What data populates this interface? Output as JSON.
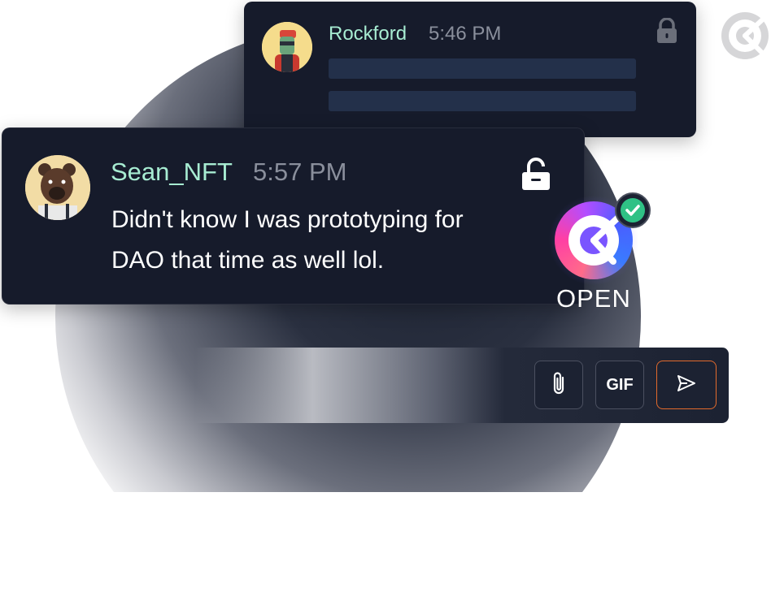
{
  "messages": {
    "rockford": {
      "name": "Rockford",
      "time": "5:46 PM",
      "avatar_icon": "punk-avatar-icon",
      "lock_icon": "lock-closed-icon"
    },
    "sean": {
      "name": "Sean_NFT",
      "time": "5:57 PM",
      "text": "Didn't know I was prototyping for DAO that time as well lol.",
      "avatar_icon": "bear-avatar-icon",
      "lock_icon": "lock-open-icon"
    }
  },
  "status": {
    "label": "OPEN",
    "icon": "check-circle-icon"
  },
  "composer": {
    "attach_icon": "paperclip-icon",
    "gif_label": "GIF",
    "send_icon": "send-icon"
  },
  "colors": {
    "card_bg": "#161b2b",
    "name": "#a7ecd2",
    "time": "#8a8f9c",
    "send_border": "#e26a2c",
    "check": "#2fc185"
  }
}
